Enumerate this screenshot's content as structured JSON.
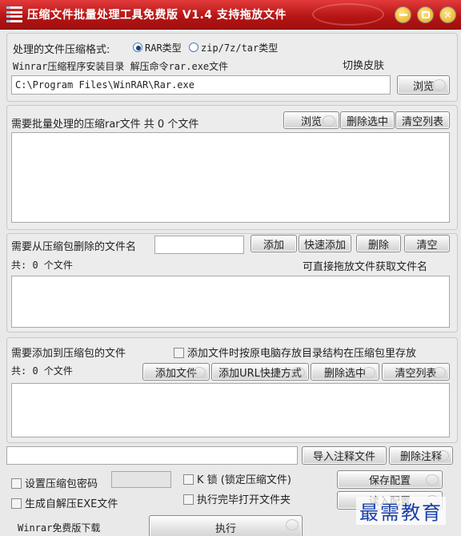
{
  "title_bar": {
    "title": "压缩文件批量处理工具免费版 V1.4   支持拖放文件"
  },
  "settings": {
    "format_label": "处理的文件压缩格式:",
    "format_options": [
      {
        "label": "RAR类型",
        "selected": true
      },
      {
        "label": "zip/7z/tar类型",
        "selected": false
      }
    ],
    "winrar_dir_label": "Winrar压缩程序安装目录 解压命令rar.exe文件",
    "switch_skin_label": "切换皮肤",
    "winrar_path_value": "C:\\Program Files\\WinRAR\\Rar.exe",
    "browse_label": "浏览"
  },
  "batch_files": {
    "label": "需要批量处理的压缩rar文件 共 0 个文件",
    "browse_label": "浏览",
    "delete_selected_label": "删除选中",
    "clear_list_label": "清空列表"
  },
  "remove_files": {
    "label": "需要从压缩包删除的文件名",
    "name_input_value": "",
    "add_label": "添加",
    "quick_add_label": "快速添加",
    "delete_label": "删除",
    "clear_label": "清空",
    "count_label": "共: 0 个文件",
    "hint": "可直接拖放文件获取文件名"
  },
  "add_files": {
    "label": "需要添加到压缩包的文件",
    "keep_structure_label": "添加文件时按原电脑存放目录结构在压缩包里存放",
    "count_label": "共: 0 个文件",
    "add_file_label": "添加文件",
    "add_url_label": "添加URL快捷方式",
    "delete_selected_label": "删除选中",
    "clear_list_label": "清空列表"
  },
  "comment": {
    "value": "",
    "import_label": "导入注释文件",
    "delete_label": "删除注释"
  },
  "options": {
    "set_password_label": "设置压缩包密码",
    "password_value": "",
    "k_lock_label": "K 锁 (锁定压缩文件)",
    "save_config_label": "保存配置",
    "sfx_label": "生成自解压EXE文件",
    "open_folder_label": "执行完毕打开文件夹",
    "read_config_label": "读入配置",
    "download_link": "Winrar免费版下载",
    "execute_label": "执行"
  },
  "watermark": "最需教育"
}
